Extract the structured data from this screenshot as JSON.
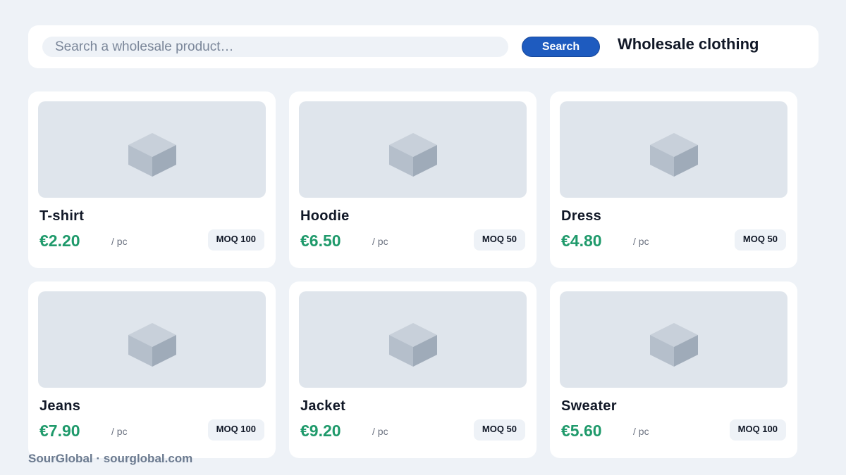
{
  "header": {
    "search_placeholder": "Search a wholesale product…",
    "search_button": "Search",
    "title": "Wholesale clothing"
  },
  "products": [
    {
      "name": "T-shirt",
      "price": "€2.20",
      "unit": "/ pc",
      "moq": "MOQ 100"
    },
    {
      "name": "Hoodie",
      "price": "€6.50",
      "unit": "/ pc",
      "moq": "MOQ 50"
    },
    {
      "name": "Dress",
      "price": "€4.80",
      "unit": "/ pc",
      "moq": "MOQ 50"
    },
    {
      "name": "Jeans",
      "price": "€7.90",
      "unit": "/ pc",
      "moq": "MOQ 100"
    },
    {
      "name": "Jacket",
      "price": "€9.20",
      "unit": "/ pc",
      "moq": "MOQ 50"
    },
    {
      "name": "Sweater",
      "price": "€5.60",
      "unit": "/ pc",
      "moq": "MOQ 100"
    }
  ],
  "footer": {
    "text": "SourGlobal · sourglobal.com"
  },
  "colors": {
    "accent": "#1e5bbf",
    "price": "#1f9a6b",
    "background": "#eef2f7"
  },
  "icons": {
    "product_placeholder": "box-icon"
  }
}
